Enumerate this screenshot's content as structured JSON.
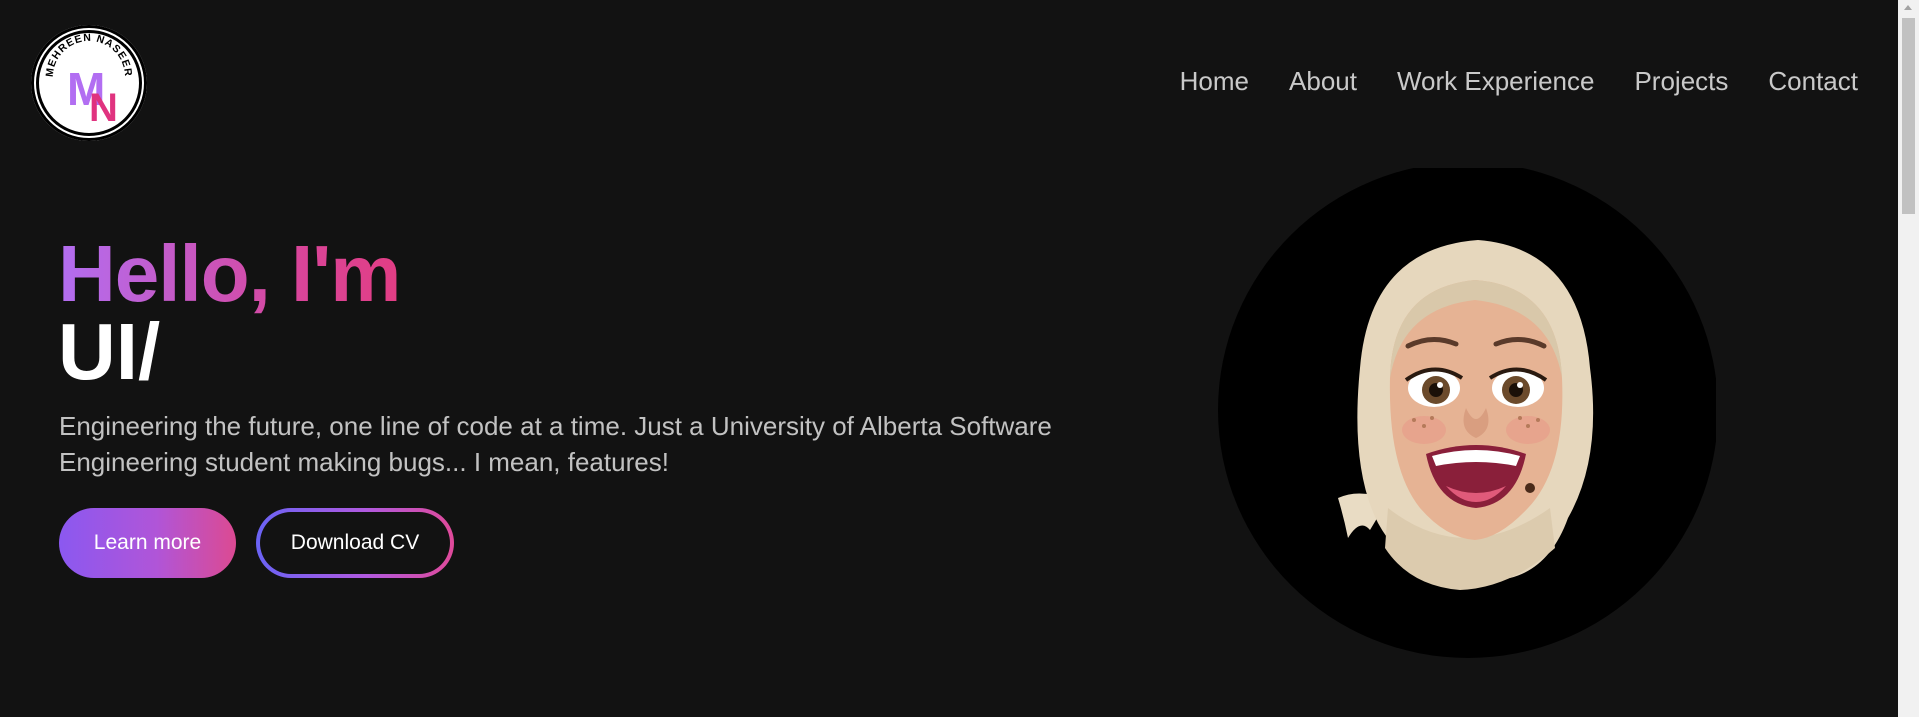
{
  "logo": {
    "arc_text": "MEHREEN NASEER",
    "letter_m": "M",
    "letter_n": "N"
  },
  "nav": {
    "items": [
      "Home",
      "About",
      "Work Experience",
      "Projects",
      "Contact"
    ]
  },
  "hero": {
    "greeting": "Hello, I'm",
    "role": "UI/",
    "description": "Engineering the future, one line of code at a time. Just a University of Alberta Software Engineering student making bugs... I mean, features!"
  },
  "buttons": {
    "learn_more": "Learn more",
    "download_cv": "Download CV"
  },
  "avatar": {
    "icon": "memoji-avatar-icon"
  },
  "colors": {
    "background": "#121212",
    "gradient_purple": "#b26ef2",
    "gradient_pink": "#e23d84",
    "nav_text": "#c9c9c9",
    "body_text": "#c2c2c2"
  }
}
